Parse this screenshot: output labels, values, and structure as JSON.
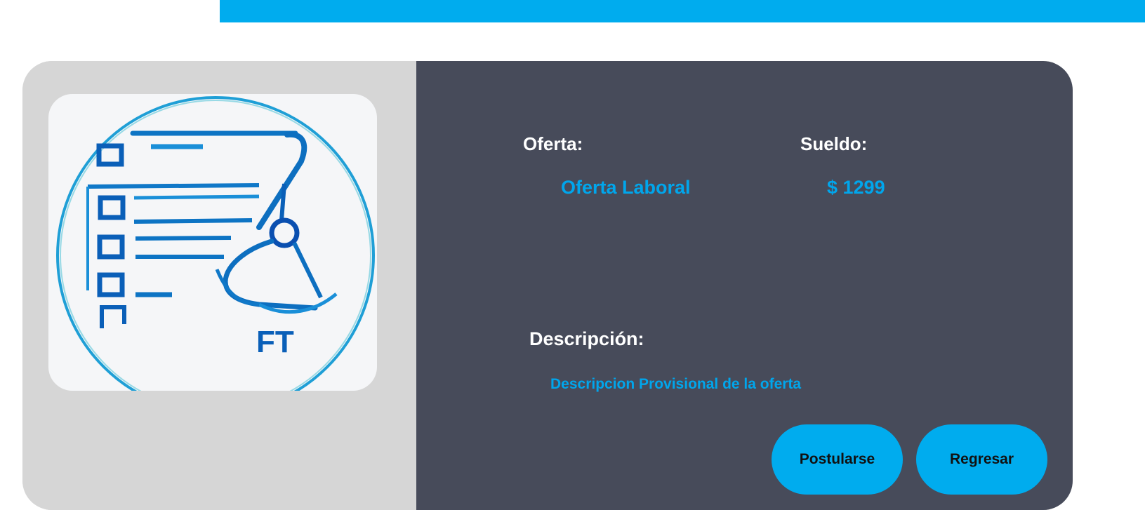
{
  "offer": {
    "title_label": "Oferta:",
    "title_value": "Oferta Laboral",
    "salary_label": "Sueldo:",
    "salary_value": "$ 1299",
    "description_label": "Descripción:",
    "description_value": "Descripcion Provisional de la oferta"
  },
  "image": {
    "icon": "job-offer-form-icon",
    "logo_letters": "FT"
  },
  "actions": {
    "apply_label": "Postularse",
    "back_label": "Regresar"
  },
  "colors": {
    "accent": "#00acee",
    "panel_dark": "#474b5a",
    "panel_light": "#d6d6d6",
    "value_text": "#00a6ec"
  }
}
